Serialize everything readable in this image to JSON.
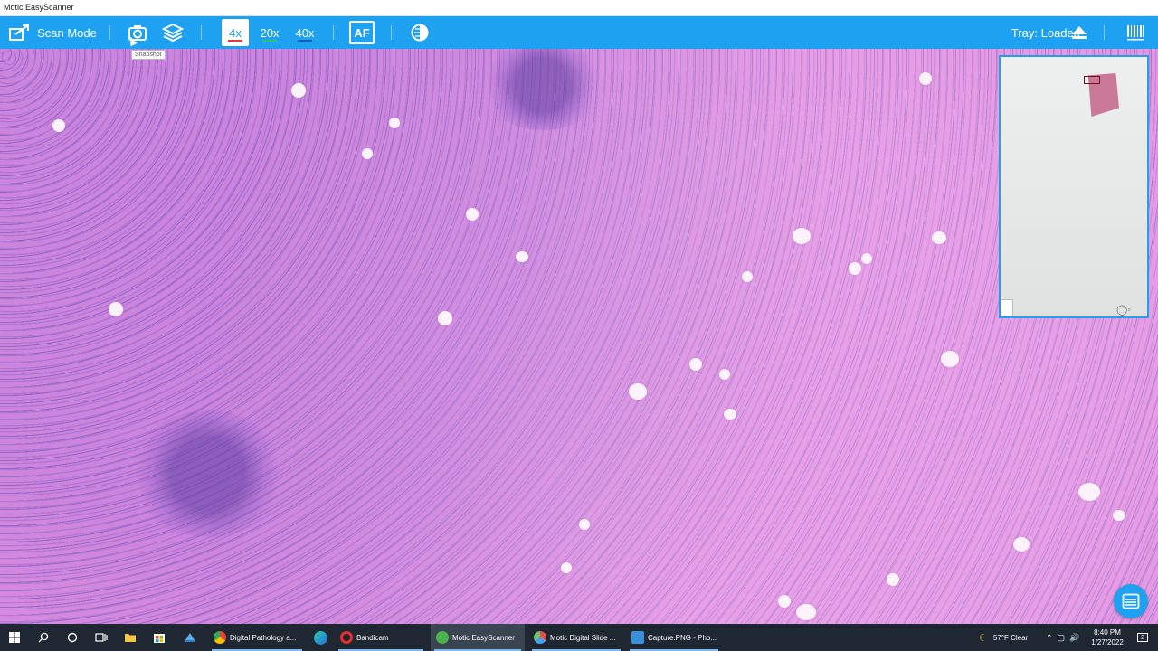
{
  "window": {
    "title": "Motic EasyScanner"
  },
  "toolbar": {
    "scan_mode_label": "Scan Mode",
    "magnifications": [
      "4x",
      "20x",
      "40x"
    ],
    "active_magnification": "4x",
    "af_label": "AF",
    "tray_status": "Tray: Loaded",
    "snapshot_tooltip": "Snapshot",
    "accent_color": "#1ea1f0"
  },
  "taskbar": {
    "apps": [
      {
        "label": "Digital Pathology a..."
      },
      {
        "label": "Bandicam"
      },
      {
        "label": "Motic EasyScanner"
      },
      {
        "label": "Motic Digital Slide ..."
      },
      {
        "label": "Capture.PNG - Pho..."
      }
    ],
    "weather": "57°F  Clear",
    "time": "8:40 PM",
    "date": "1/27/2022",
    "notification_count": "2"
  }
}
